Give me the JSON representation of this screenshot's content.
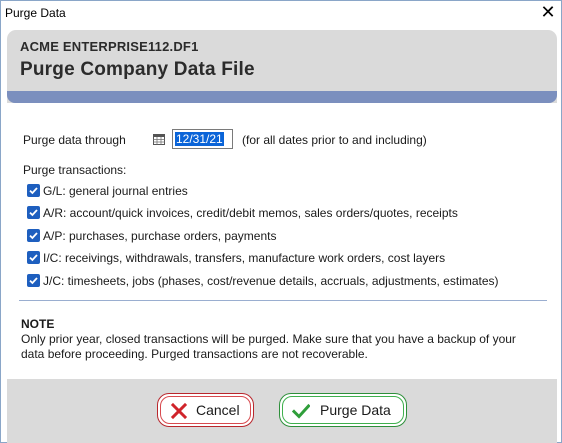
{
  "window": {
    "title": "Purge Data",
    "close_glyph": "✕"
  },
  "header": {
    "company": "ACME ENTERPRISE112.DF1",
    "title": "Purge Company Data File"
  },
  "through": {
    "label": "Purge data through",
    "date_value": "12/31/21",
    "hint": "(for all dates prior to and including)"
  },
  "transactions": {
    "label": "Purge transactions:",
    "items": [
      {
        "label": "G/L: general journal entries",
        "checked": true
      },
      {
        "label": "A/R: account/quick invoices, credit/debit memos, sales orders/quotes, receipts",
        "checked": true
      },
      {
        "label": "A/P: purchases, purchase orders, payments",
        "checked": true
      },
      {
        "label": "I/C: receivings, withdrawals, transfers, manufacture work orders, cost layers",
        "checked": true
      },
      {
        "label": "J/C: timesheets, jobs (phases, cost/revenue details, accruals, adjustments, estimates)",
        "checked": true
      }
    ]
  },
  "note": {
    "title": "NOTE",
    "text": "Only prior year, closed transactions will be purged. Make sure that you have a backup of your data before proceeding. Purged transactions are not recoverable."
  },
  "buttons": {
    "cancel_label": "Cancel",
    "purge_label": "Purge Data"
  },
  "colors": {
    "accent_bar": "#7b8fbe",
    "checkbox": "#1e5fbf",
    "cancel_border": "#b9262c",
    "purge_border": "#2d8f3a"
  },
  "icons": {
    "calendar": "calendar-icon",
    "cancel": "x-icon",
    "purge": "checkmark-icon"
  }
}
